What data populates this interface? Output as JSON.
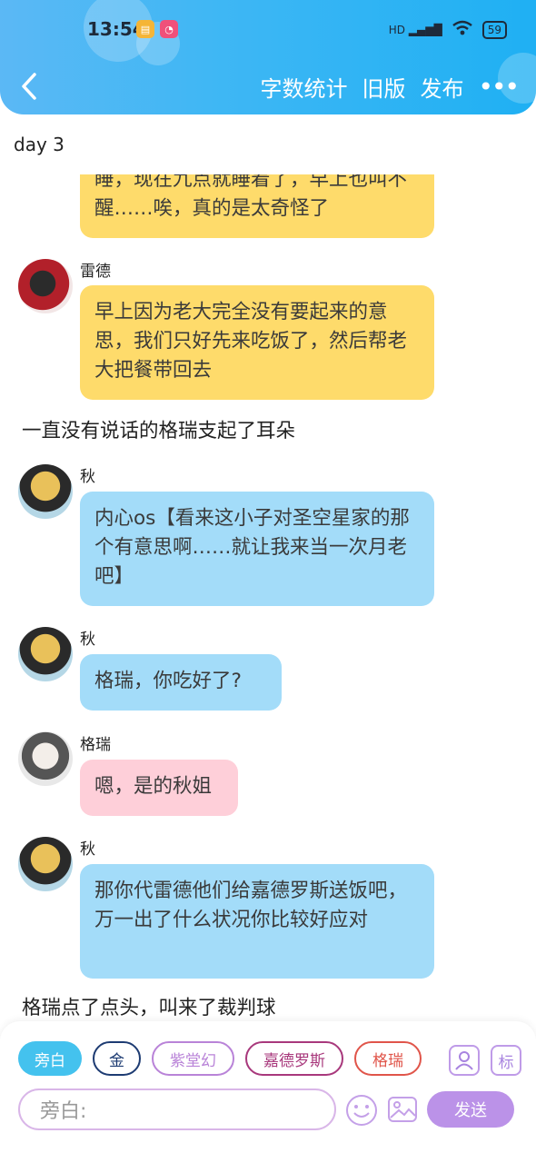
{
  "status": {
    "time": "13:54",
    "signal": "HD",
    "battery": "59"
  },
  "nav": {
    "actions": [
      "字数统计",
      "旧版",
      "发布"
    ]
  },
  "chapter": "day 3",
  "messages": [
    {
      "text": "睡，现在九点就睡着了，早上也叫不醒……唉，真的是太奇怪了"
    },
    {
      "name": "雷德",
      "text": "早上因为老大完全没有要起来的意思，我们只好先来吃饭了，然后帮老大把餐带回去"
    },
    {
      "narration": "一直没有说话的格瑞支起了耳朵"
    },
    {
      "name": "秋",
      "text": "内心os【看来这小子对圣空星家的那个有意思啊……就让我来当一次月老吧】"
    },
    {
      "name": "秋",
      "text": "格瑞，你吃好了?"
    },
    {
      "name": "格瑞",
      "text": "嗯，是的秋姐"
    },
    {
      "name": "秋",
      "text": "那你代雷德他们给嘉德罗斯送饭吧，万一出了什么状况你比较好应对"
    },
    {
      "narration": "格瑞点了点头，叫来了裁判球"
    }
  ],
  "composer": {
    "roles": [
      "旁白",
      "金",
      "紫堂幻",
      "嘉德罗斯",
      "格瑞"
    ],
    "role_tool": "标",
    "placeholder": "旁白:",
    "send_label": "发送"
  },
  "colors": {
    "header": "#3fb7f4",
    "yellow_bubble": "#fedb6b",
    "blue_bubble": "#a3dcf9",
    "pink_bubble": "#fecfd9",
    "send": "#bb92e8"
  }
}
